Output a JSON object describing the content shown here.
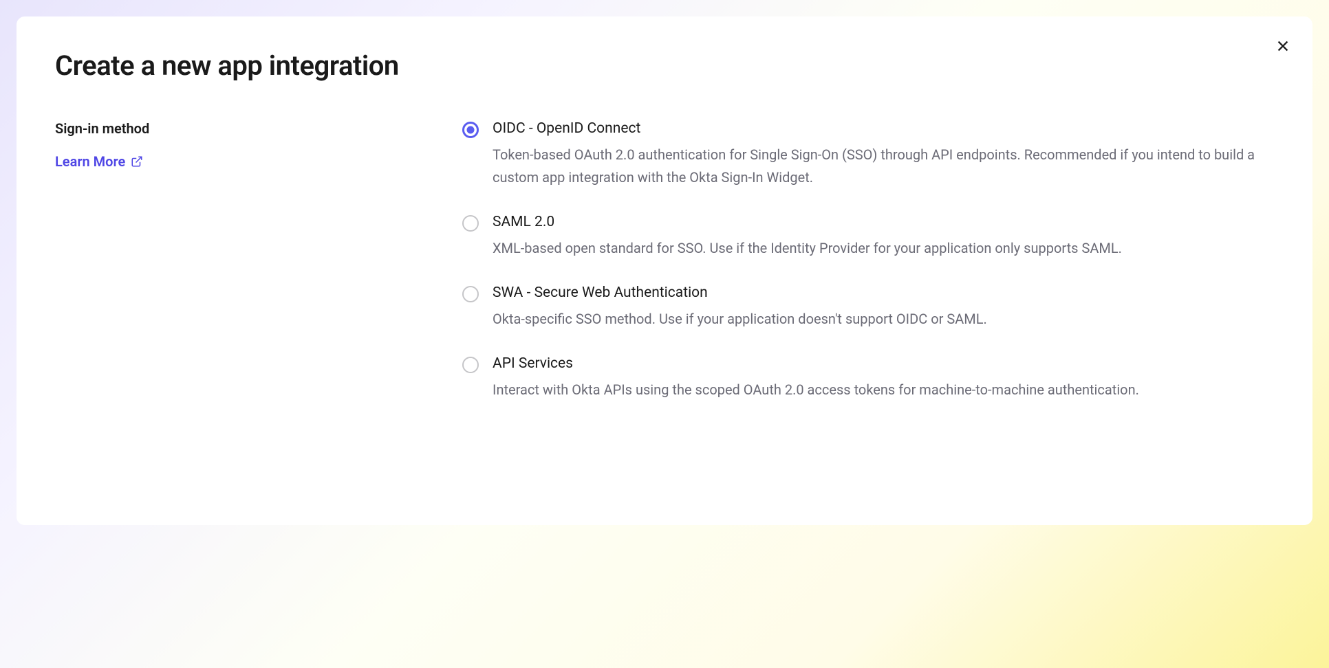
{
  "modal": {
    "title": "Create a new app integration",
    "section_label": "Sign-in method",
    "learn_more_label": "Learn More",
    "options": [
      {
        "title": "OIDC - OpenID Connect",
        "description": "Token-based OAuth 2.0 authentication for Single Sign-On (SSO) through API endpoints. Recommended if you intend to build a custom app integration with the Okta Sign-In Widget.",
        "selected": true
      },
      {
        "title": "SAML 2.0",
        "description": "XML-based open standard for SSO. Use if the Identity Provider for your application only supports SAML.",
        "selected": false
      },
      {
        "title": "SWA - Secure Web Authentication",
        "description": "Okta-specific SSO method. Use if your application doesn't support OIDC or SAML.",
        "selected": false
      },
      {
        "title": "API Services",
        "description": "Interact with Okta APIs using the scoped OAuth 2.0 access tokens for machine-to-machine authentication.",
        "selected": false
      }
    ]
  }
}
